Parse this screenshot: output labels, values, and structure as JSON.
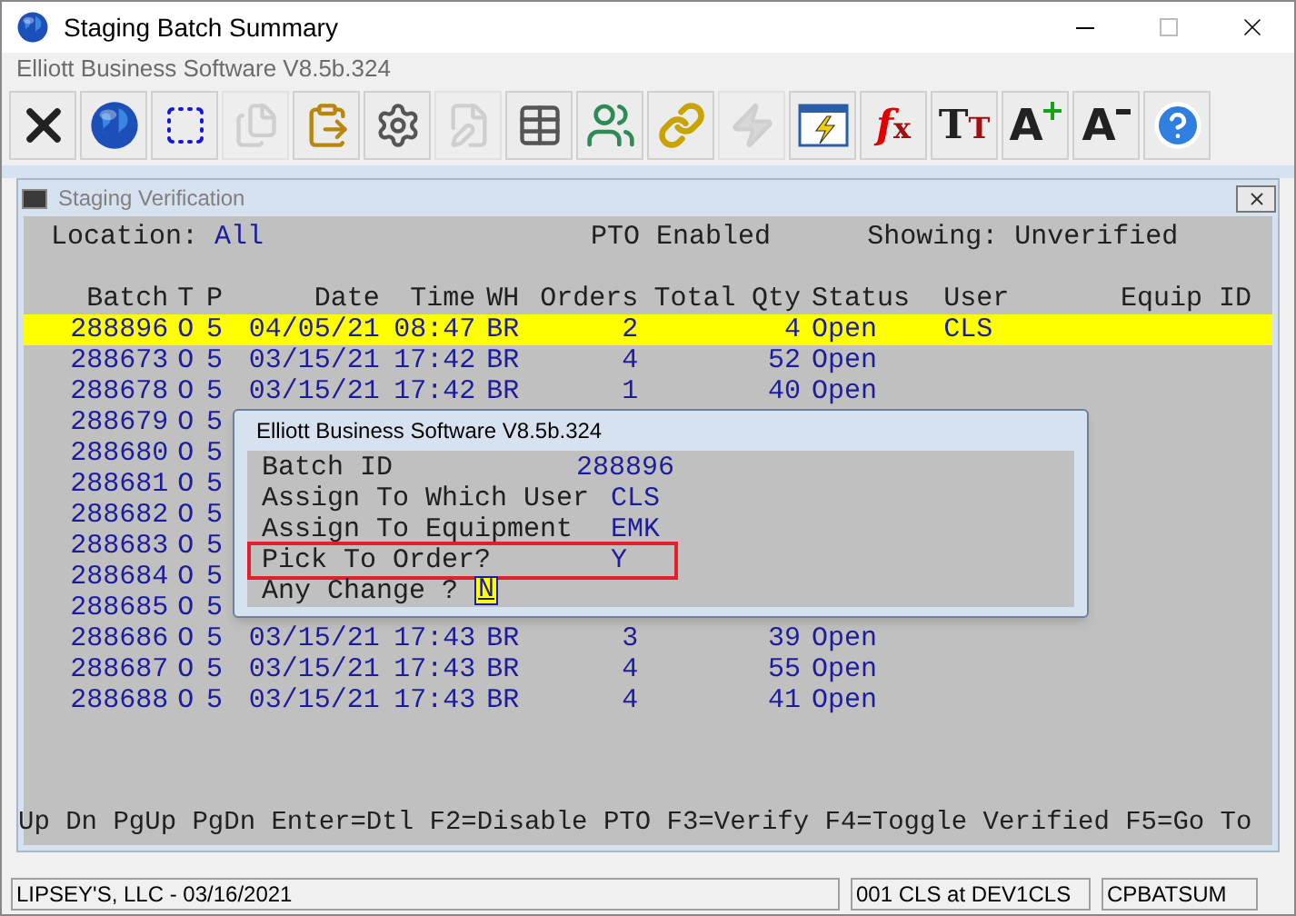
{
  "window": {
    "title": "Staging Batch Summary",
    "subtitle": "Elliott Business Software V8.5b.324"
  },
  "toolbar": [
    {
      "kind": "close",
      "disabled": false
    },
    {
      "kind": "globe",
      "disabled": false
    },
    {
      "kind": "select",
      "disabled": false
    },
    {
      "kind": "copy",
      "disabled": true
    },
    {
      "kind": "paste",
      "disabled": false
    },
    {
      "kind": "settings",
      "disabled": false
    },
    {
      "kind": "edit",
      "disabled": true
    },
    {
      "kind": "table",
      "disabled": false
    },
    {
      "kind": "users",
      "disabled": false
    },
    {
      "kind": "link",
      "disabled": false
    },
    {
      "kind": "zap",
      "disabled": true
    },
    {
      "kind": "window-zap",
      "disabled": false
    },
    {
      "kind": "glyph",
      "glyph": "fx",
      "disabled": false
    },
    {
      "kind": "glyph",
      "glyph": "TT",
      "disabled": false
    },
    {
      "kind": "font-up",
      "glyph": "A",
      "disabled": false
    },
    {
      "kind": "font-down",
      "glyph": "A",
      "disabled": false
    },
    {
      "kind": "help",
      "disabled": false
    }
  ],
  "panel": {
    "title": "Staging Verification",
    "location_label": "Location:",
    "location_value": "All",
    "pto": "PTO Enabled",
    "showing": "Showing: Unverified",
    "columns": [
      "Batch",
      "T",
      "P",
      "Date",
      "Time",
      "WH",
      "Orders",
      "Total",
      "Qty",
      "Status",
      "User",
      "Equip ID"
    ],
    "rows": [
      {
        "selected": true,
        "cells": [
          "288896",
          "O",
          "5",
          "04/05/21",
          "08:47",
          "BR",
          "2",
          "",
          "4",
          "Open",
          "CLS",
          ""
        ]
      },
      {
        "selected": false,
        "cells": [
          "288673",
          "O",
          "5",
          "03/15/21",
          "17:42",
          "BR",
          "4",
          "",
          "52",
          "Open",
          "",
          ""
        ]
      },
      {
        "selected": false,
        "cells": [
          "288678",
          "O",
          "5",
          "03/15/21",
          "17:42",
          "BR",
          "1",
          "",
          "40",
          "Open",
          "",
          ""
        ]
      },
      {
        "selected": false,
        "cells": [
          "288679",
          "O",
          "5"
        ]
      },
      {
        "selected": false,
        "cells": [
          "288680",
          "O",
          "5"
        ]
      },
      {
        "selected": false,
        "cells": [
          "288681",
          "O",
          "5"
        ]
      },
      {
        "selected": false,
        "cells": [
          "288682",
          "O",
          "5"
        ]
      },
      {
        "selected": false,
        "cells": [
          "288683",
          "O",
          "5"
        ]
      },
      {
        "selected": false,
        "cells": [
          "288684",
          "O",
          "5"
        ]
      },
      {
        "selected": false,
        "cells": [
          "288685",
          "O",
          "5"
        ]
      },
      {
        "selected": false,
        "cells": [
          "288686",
          "O",
          "5",
          "03/15/21",
          "17:43",
          "BR",
          "3",
          "",
          "39",
          "Open",
          "",
          ""
        ]
      },
      {
        "selected": false,
        "cells": [
          "288687",
          "O",
          "5",
          "03/15/21",
          "17:43",
          "BR",
          "4",
          "",
          "55",
          "Open",
          "",
          ""
        ]
      },
      {
        "selected": false,
        "cells": [
          "288688",
          "O",
          "5",
          "03/15/21",
          "17:43",
          "BR",
          "4",
          "",
          "41",
          "Open",
          "",
          ""
        ]
      }
    ],
    "keys": "Up Dn PgUp PgDn Enter=Dtl F2=Disable PTO F3=Verify F4=Toggle Verified F5=Go To"
  },
  "dialog": {
    "title": "Elliott Business Software V8.5b.324",
    "fields": [
      {
        "label": "Batch ID",
        "value": "288896",
        "highlighted": false
      },
      {
        "label": "Assign To Which User",
        "value": "CLS",
        "highlighted": false
      },
      {
        "label": "Assign To Equipment",
        "value": "EMK",
        "highlighted": false
      },
      {
        "label": "Pick To Order?",
        "value": "Y",
        "highlighted": true
      }
    ],
    "prompt": "Any Change ?",
    "answer": "N"
  },
  "status_bar": [
    "LIPSEY'S, LLC - 03/16/2021",
    "001 CLS at DEV1CLS",
    "CPBATSUM"
  ]
}
